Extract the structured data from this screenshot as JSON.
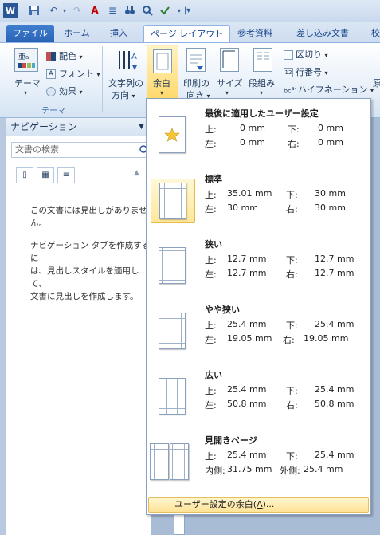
{
  "qat": {
    "icons": [
      "word-app-icon",
      "save-icon",
      "undo-icon",
      "redo-icon",
      "text-color-icon",
      "align-icon",
      "binoculars-icon",
      "zoom-icon",
      "spellcheck-icon",
      "qat-menu-icon"
    ]
  },
  "tabs": [
    {
      "label": "ファイル",
      "state": "file"
    },
    {
      "label": "ホーム",
      "state": "normal"
    },
    {
      "label": "挿入",
      "state": "normal"
    },
    {
      "label": "ページ レイアウト",
      "state": "active"
    },
    {
      "label": "参考資料",
      "state": "normal"
    },
    {
      "label": "差し込み文書",
      "state": "normal"
    },
    {
      "label": "校",
      "state": "normal"
    }
  ],
  "ribbon": {
    "theme_button": "テーマ",
    "color_button": "配色",
    "font_button": "フォント",
    "effect_button": "効果",
    "theme_group_label": "テーマ",
    "direction_button_line1": "文字列の",
    "direction_button_line2": "方向",
    "margins_button": "余白",
    "orientation_line1": "印刷の",
    "orientation_line2": "向き",
    "size_button": "サイズ",
    "columns_button": "段組み",
    "breaks_button": "区切り",
    "line_numbers_button": "行番号",
    "hyphenation_button": "ハイフネーション",
    "right_cut_1": "原",
    "right_cut_2": "原"
  },
  "nav": {
    "title": "ナビゲーション",
    "search_placeholder": "文書の検索",
    "msg1_line1": "この文書には見出しがありませ",
    "msg1_line2": "ん。",
    "msg2_line1": "ナビゲーション タブを作成するに",
    "msg2_line2": "は、見出しスタイルを適用して、",
    "msg2_line3": "文書に見出しを作成します。"
  },
  "margins_menu": {
    "items": [
      {
        "title": "最後に適用したユーザー設定",
        "l1": "上:",
        "v1": "0 mm",
        "l2": "下:",
        "v2": "0 mm",
        "l3": "左:",
        "v3": "0 mm",
        "l4": "右:",
        "v4": "0 mm"
      },
      {
        "title": "標準",
        "l1": "上:",
        "v1": "35.01 mm",
        "l2": "下:",
        "v2": "30 mm",
        "l3": "左:",
        "v3": "30 mm",
        "l4": "右:",
        "v4": "30 mm"
      },
      {
        "title": "狭い",
        "l1": "上:",
        "v1": "12.7 mm",
        "l2": "下:",
        "v2": "12.7 mm",
        "l3": "左:",
        "v3": "12.7 mm",
        "l4": "右:",
        "v4": "12.7 mm"
      },
      {
        "title": "やや狭い",
        "l1": "上:",
        "v1": "25.4 mm",
        "l2": "下:",
        "v2": "25.4 mm",
        "l3": "左:",
        "v3": "19.05 mm",
        "l4": "右:",
        "v4": "19.05 mm"
      },
      {
        "title": "広い",
        "l1": "上:",
        "v1": "25.4 mm",
        "l2": "下:",
        "v2": "25.4 mm",
        "l3": "左:",
        "v3": "50.8 mm",
        "l4": "右:",
        "v4": "50.8 mm"
      },
      {
        "title": "見開きページ",
        "l1": "上:",
        "v1": "25.4 mm",
        "l2": "下:",
        "v2": "25.4 mm",
        "l3": "内側:",
        "v3": "31.75 mm",
        "l4": "外側:",
        "v4": "25.4 mm"
      }
    ],
    "custom_prefix": "ユーザー設定の余白(",
    "custom_key": "A",
    "custom_suffix": ")..."
  },
  "colors": {
    "accent": "#2a62b4",
    "highlight": "#ffe397"
  }
}
